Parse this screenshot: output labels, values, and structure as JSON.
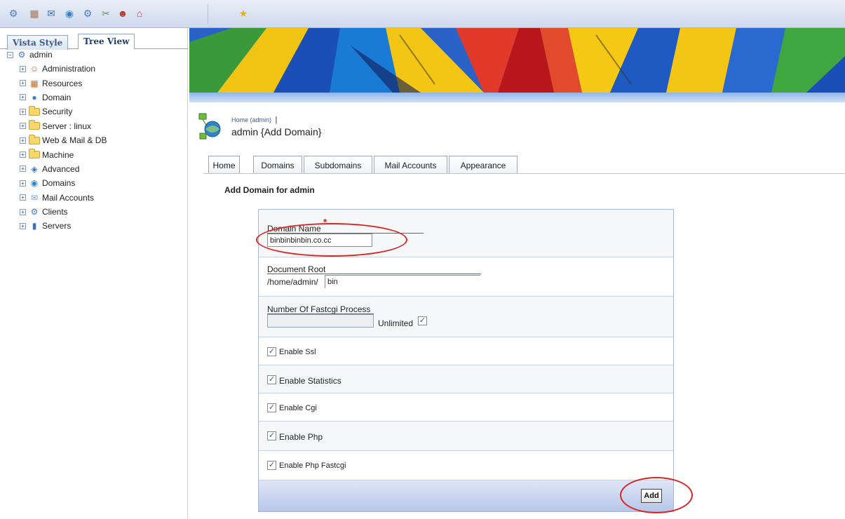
{
  "toolbar": {
    "icons": [
      "gear-person-icon",
      "resources-icon",
      "mail-icon",
      "globe-icon",
      "gear-person-icon",
      "tools-icon",
      "user-icon",
      "home-icon",
      "star-icon"
    ]
  },
  "left_panel": {
    "tabs": [
      {
        "label": "Vista Style"
      },
      {
        "label": "Tree View"
      }
    ],
    "tree": {
      "root": "admin",
      "items": [
        {
          "label": "Administration"
        },
        {
          "label": "Resources"
        },
        {
          "label": "Domain"
        },
        {
          "label": "Security"
        },
        {
          "label": "Server : linux"
        },
        {
          "label": "Web & Mail & DB"
        },
        {
          "label": "Machine"
        },
        {
          "label": "Advanced"
        },
        {
          "label": "Domains"
        },
        {
          "label": "Mail Accounts"
        },
        {
          "label": "Clients"
        },
        {
          "label": "Servers"
        }
      ]
    }
  },
  "header": {
    "breadcrumb": "Home (admin)",
    "breadcrumb_sep": "|",
    "title": "admin {Add Domain}"
  },
  "nav_tabs": [
    {
      "label": "Home"
    },
    {
      "label": "Domains"
    },
    {
      "label": "Subdomains"
    },
    {
      "label": "Mail Accounts"
    },
    {
      "label": "Appearance"
    }
  ],
  "form": {
    "section_title": "Add Domain for admin",
    "domain_name": {
      "label": "Domain Name",
      "required_mark": "*",
      "value": "binbinbinbin.co.cc"
    },
    "document_root": {
      "label": "Document Root",
      "prefix": "/home/admin/",
      "value": "bin"
    },
    "fastcgi": {
      "label": "Number Of Fastcgi Process",
      "value": "",
      "unlimited_label": "Unlimited",
      "unlimited_checked": true
    },
    "checkboxes": [
      {
        "label": "Enable Ssl",
        "checked": true
      },
      {
        "label": "Enable Statistics",
        "checked": true
      },
      {
        "label": "Enable Cgi",
        "checked": true
      },
      {
        "label": "Enable Php",
        "checked": true
      },
      {
        "label": "Enable Php Fastcgi",
        "checked": true
      }
    ],
    "submit_label": "Add"
  },
  "colors": {
    "annotation": "#d62626",
    "footer_bar": "#c6d2ee",
    "link": "#3b5aa5"
  }
}
